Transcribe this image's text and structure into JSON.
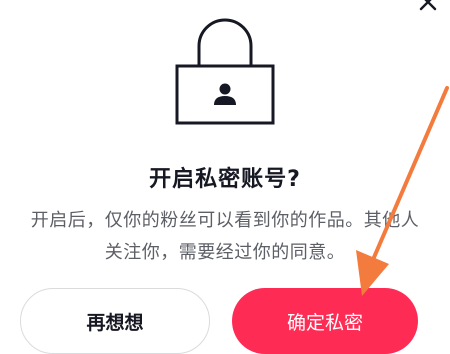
{
  "dialog": {
    "title": "开启私密账号?",
    "description": "开启后，仅你的粉丝可以看到你的作品。其他人关注你，需要经过你的同意。",
    "cancel_label": "再想想",
    "confirm_label": "确定私密"
  },
  "icons": {
    "close": "close-icon",
    "lock": "lock-user-icon",
    "annotation": "orange-arrow-annotation"
  },
  "colors": {
    "primary": "#fe2c55",
    "text": "#161823",
    "secondary_text": "#5c5f66",
    "annotation": "#f47b3e"
  }
}
